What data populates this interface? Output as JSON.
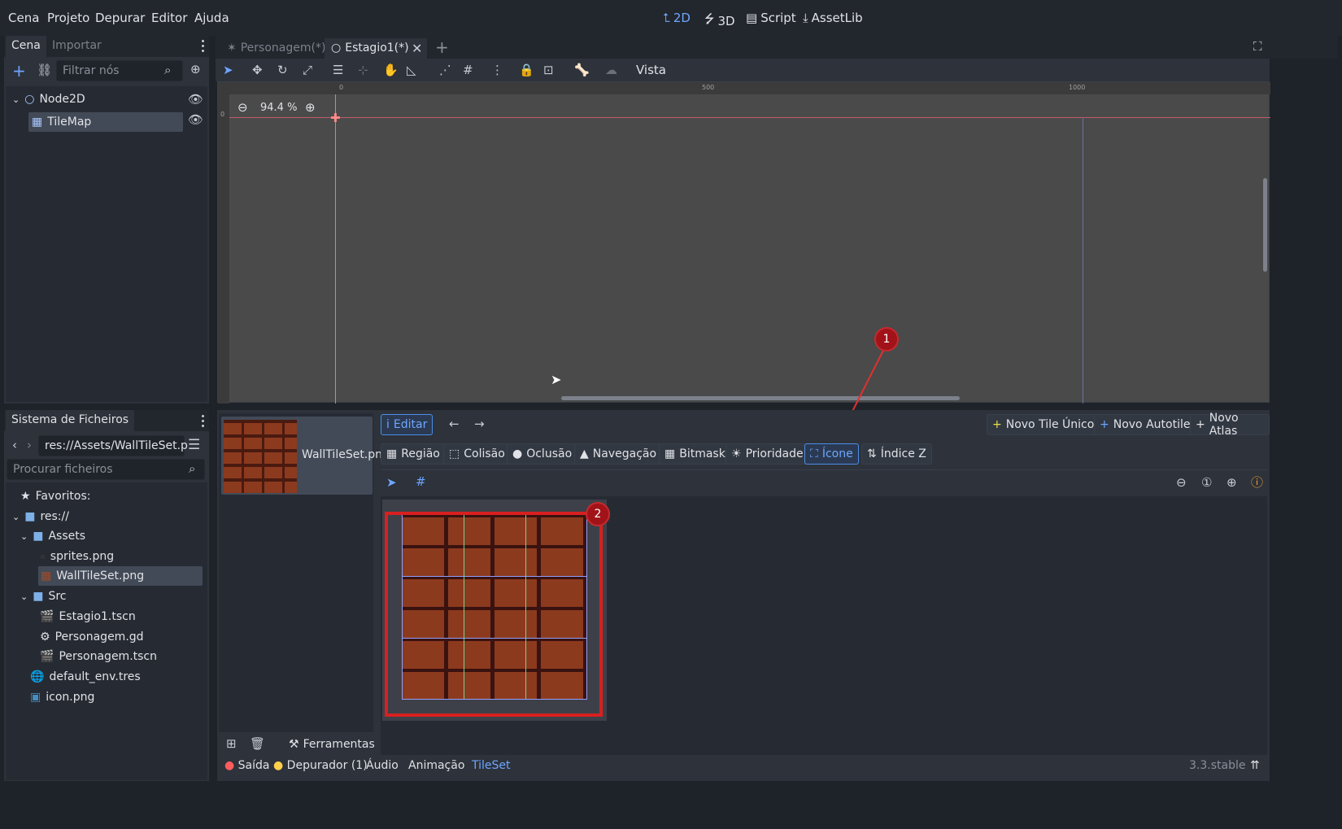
{
  "menu": {
    "items": [
      "Cena",
      "Projeto",
      "Depurar",
      "Editor",
      "Ajuda"
    ]
  },
  "modes": {
    "m2d": "2D",
    "m3d": "3D",
    "script": "Script",
    "assetlib": "AssetLib"
  },
  "scene_dock": {
    "tab_scene": "Cena",
    "tab_import": "Importar",
    "filter_placeholder": "Filtrar nós",
    "nodes": [
      "Node2D",
      "TileMap"
    ]
  },
  "editor_tabs": {
    "tab1": "Personagem(*)",
    "tab2": "Estagio1(*)"
  },
  "toolbar": {
    "view_label": "Vista"
  },
  "viewport": {
    "zoom": "94.4 %",
    "ruler_labels": [
      "0",
      "500",
      "1000"
    ],
    "ruler_v_label": "0"
  },
  "annotations": {
    "marker1": "1",
    "marker2": "2"
  },
  "filesystem": {
    "title": "Sistema de Ficheiros",
    "path": "res://Assets/WallTileSet.p",
    "search_placeholder": "Procurar ficheiros",
    "favorites": "Favoritos:",
    "root": "res://",
    "assets": "Assets",
    "sprites": "sprites.png",
    "walltileset": "WallTileSet.png",
    "src": "Src",
    "estagio": "Estagio1.tscn",
    "pers_gd": "Personagem.gd",
    "pers_tscn": "Personagem.tscn",
    "env": "default_env.tres",
    "icon": "icon.png"
  },
  "tileset": {
    "texture_name": "WallTileSet.pn",
    "edit": "Editar",
    "new_single": "Novo Tile Único",
    "new_autotile": "Novo Autotile",
    "new_atlas": "Novo Atlas",
    "modes": [
      "Região",
      "Colisão",
      "Oclusão",
      "Navegação",
      "Bitmask",
      "Prioridade",
      "Ícone",
      "Índice Z"
    ],
    "tools": "Ferramentas"
  },
  "bottom": {
    "output": "Saída",
    "debugger": "Depurador (1)",
    "audio": "Áudio",
    "animation": "Animação",
    "tileset": "TileSet",
    "version": "3.3.stable"
  },
  "colors": {
    "accent": "#6ea6ff",
    "annotation": "#b3141a",
    "brick": "#8c3a1e"
  }
}
